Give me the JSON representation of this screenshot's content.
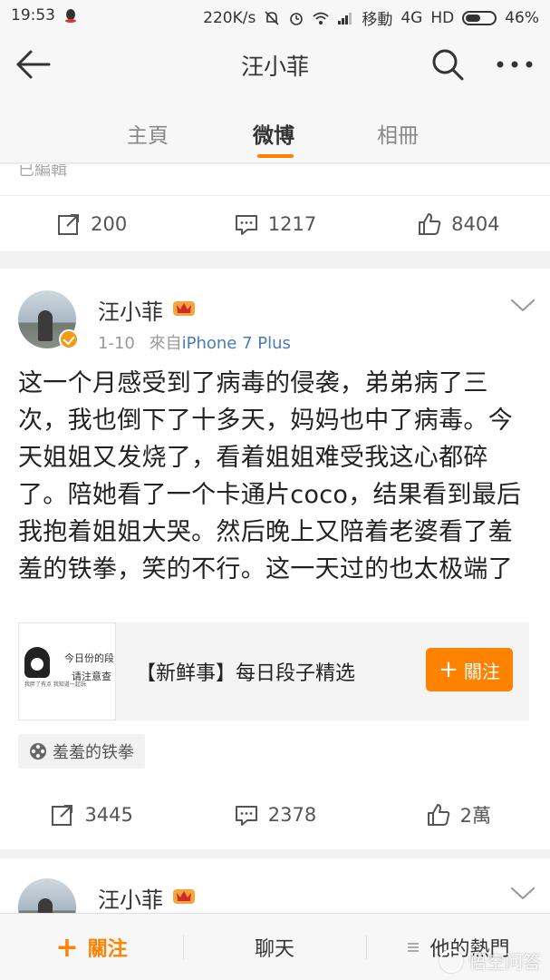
{
  "status_bar": {
    "time": "19:53",
    "speed": "220K/s",
    "carrier": "移動",
    "network": "4G",
    "hd": "HD",
    "battery": "46%"
  },
  "header": {
    "title": "汪小菲",
    "icons": [
      "back-arrow-icon",
      "search-icon",
      "more-icon"
    ]
  },
  "tabs": [
    {
      "label": "主頁",
      "active": false
    },
    {
      "label": "微博",
      "active": true
    },
    {
      "label": "相冊",
      "active": false
    }
  ],
  "previous_post": {
    "clipped_text": "已編輯",
    "reposts": "200",
    "comments": "1217",
    "likes": "8404"
  },
  "post": {
    "author": "汪小菲",
    "date": "1-10",
    "source_prefix": "來自",
    "source": "iPhone 7 Plus",
    "text": "这一个月感受到了病毒的侵袭，弟弟病了三次，我也倒下了十多天，妈妈也中了病毒。今天姐姐又发烧了，看着姐姐难受我这心都碎了。陪她看了一个卡通片coco，结果看到最后我抱着姐姐大哭。然后晚上又陪着老婆看了羞羞的铁拳，笑的不行。这一天过的也太极端了",
    "embed": {
      "thumb_line1": "今日份的段",
      "thumb_line2": "请注意查",
      "thumb_small": "我胖了有点 我知道一起玩",
      "title": "【新鲜事】每日段子精选",
      "follow_label": "關注"
    },
    "tag": "羞羞的铁拳",
    "reposts": "3445",
    "comments": "2378",
    "likes": "2萬"
  },
  "next_post": {
    "author": "汪小菲"
  },
  "bottom_bar": {
    "follow_label": "關注",
    "chat_label": "聊天",
    "hot_label": "他的熱門"
  },
  "watermark": "悟空问答",
  "colors": {
    "accent": "#ff8200",
    "link": "#4a7ab8",
    "verified": "#f29b16"
  }
}
